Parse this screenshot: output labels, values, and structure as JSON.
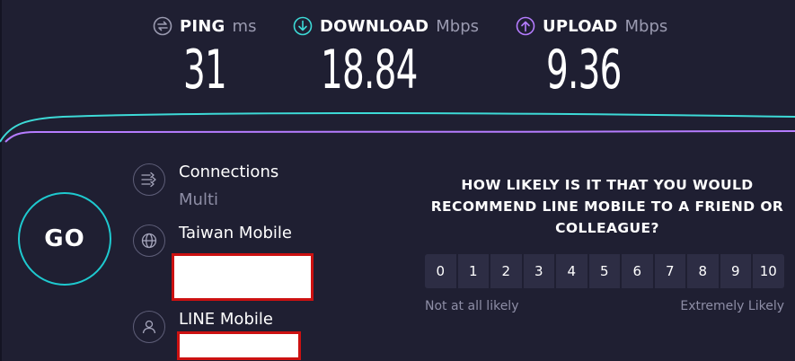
{
  "metrics": {
    "ping": {
      "label": "PING",
      "unit": "ms",
      "value": "31",
      "icon": "ping-icon",
      "color": "#8e8ea6"
    },
    "download": {
      "label": "DOWNLOAD",
      "unit": "Mbps",
      "value": "18.84",
      "icon": "download-arrow-icon",
      "color": "#3ddad7"
    },
    "upload": {
      "label": "UPLOAD",
      "unit": "Mbps",
      "value": "9.36",
      "icon": "upload-arrow-icon",
      "color": "#b57cff"
    }
  },
  "go_button": {
    "label": "GO",
    "accent": "#1ec9cf"
  },
  "server": {
    "connections_label": "Connections",
    "connections_mode": "Multi",
    "isp_name": "Taiwan Mobile",
    "host_name": "LINE Mobile"
  },
  "survey": {
    "question": "HOW LIKELY IS IT THAT YOU WOULD RECOMMEND LINE MOBILE TO A FRIEND OR COLLEAGUE?",
    "scale": [
      "0",
      "1",
      "2",
      "3",
      "4",
      "5",
      "6",
      "7",
      "8",
      "9",
      "10"
    ],
    "low_label": "Not at all likely",
    "high_label": "Extremely Likely"
  }
}
